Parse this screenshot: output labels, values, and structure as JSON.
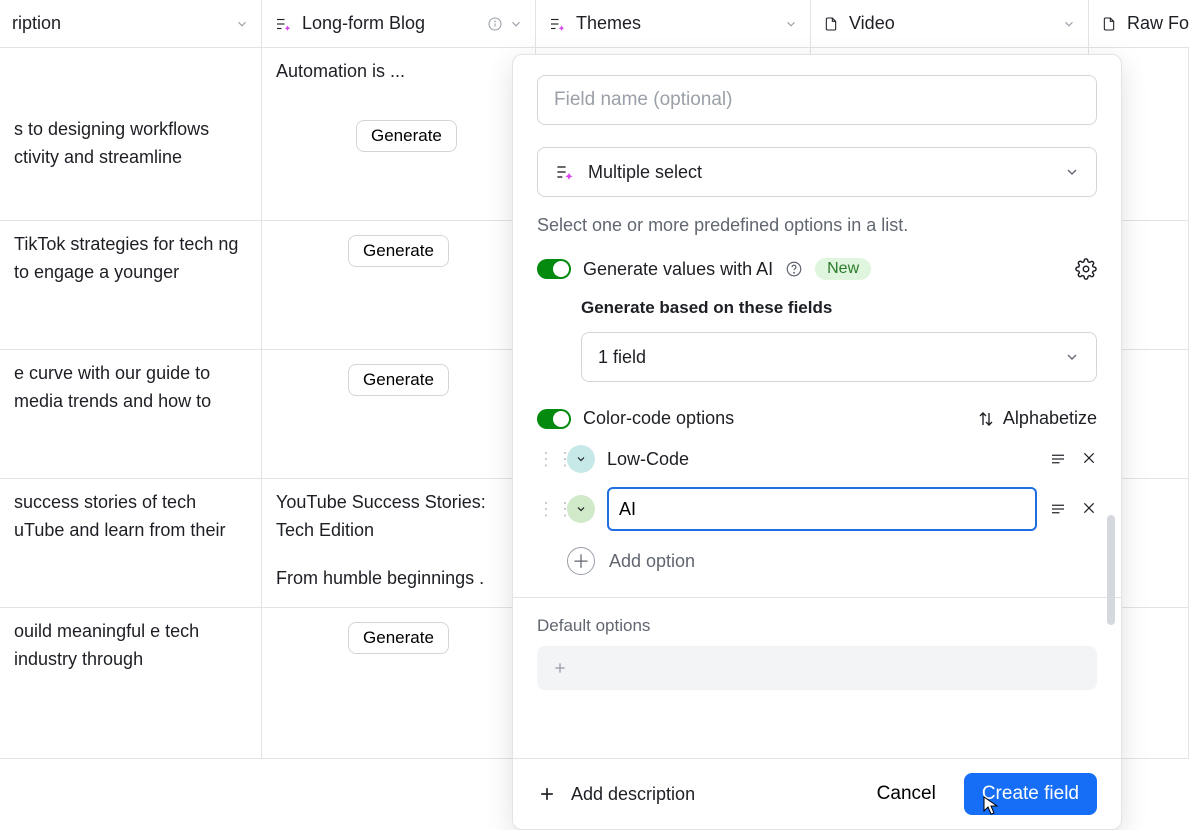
{
  "columns": {
    "description": {
      "label": "ription"
    },
    "blog": {
      "label": "Long-form Blog"
    },
    "themes": {
      "label": "Themes"
    },
    "video": {
      "label": "Video"
    },
    "raw": {
      "label": "Raw Fo"
    }
  },
  "generate_label": "Generate",
  "rows": [
    {
      "desc": "Automation is ..."
    },
    {
      "desc": "s to designing workflows ctivity and streamline"
    },
    {
      "desc": "TikTok strategies for tech ng to engage a younger"
    },
    {
      "desc": "e curve with our guide to media trends and how to"
    },
    {
      "desc": "success stories of tech uTube and learn from their",
      "blog_title": "YouTube Success Stories: Tech Edition",
      "blog_sub": "From humble beginnings ."
    },
    {
      "desc": "ouild meaningful e tech industry through"
    }
  ],
  "popover": {
    "placeholder": "Field name (optional)",
    "type_label": "Multiple select",
    "helper": "Select one or more predefined options in a list.",
    "ai_toggle_label": "Generate values with AI",
    "new_badge": "New",
    "based_on_label": "Generate based on these fields",
    "fields_selected": "1 field",
    "color_code_label": "Color-code options",
    "alphabetize_label": "Alphabetize",
    "options": [
      {
        "label": "Low-Code",
        "color": "teal"
      },
      {
        "label": "AI",
        "color": "green",
        "editing": true
      }
    ],
    "add_option_label": "Add option",
    "default_label": "Default options",
    "add_description_label": "Add description",
    "cancel_label": "Cancel",
    "create_label": "Create field"
  }
}
